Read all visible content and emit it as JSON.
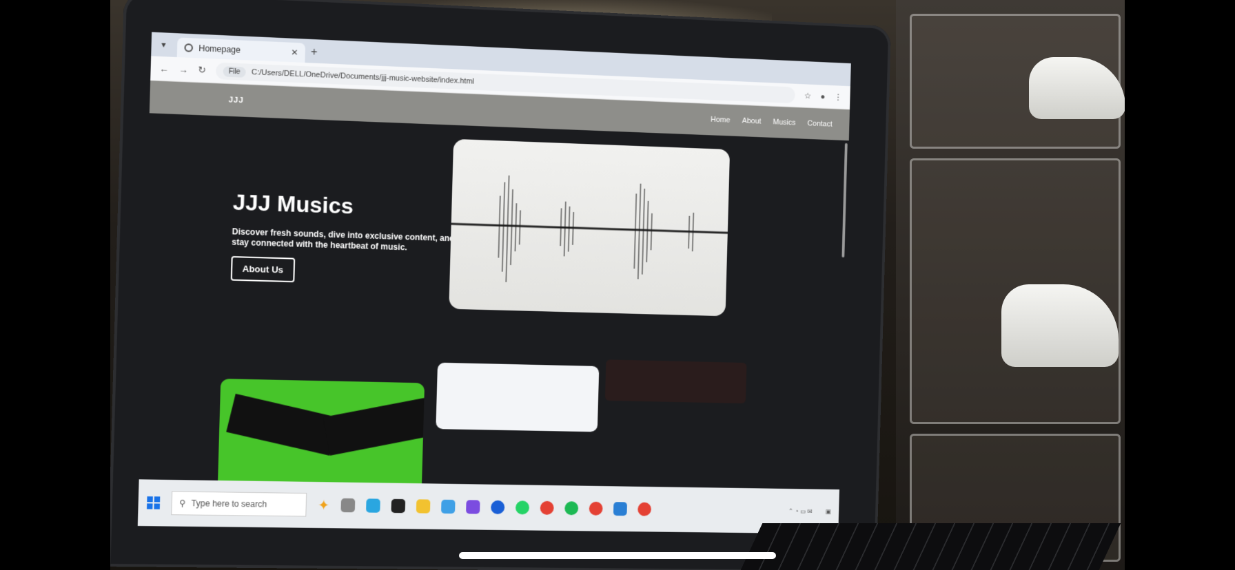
{
  "browser": {
    "tab_title": "Homepage",
    "file_chip": "File",
    "address": "C:/Users/DELL/OneDrive/Documents/jjj-music-website/index.html"
  },
  "site": {
    "logo": "JJJ",
    "nav": [
      "Home",
      "About",
      "Musics",
      "Contact"
    ],
    "hero_title": "JJJ Musics",
    "hero_subtitle": "Discover fresh sounds, dive into exclusive content, and stay connected with the heartbeat of music.",
    "hero_button": "About Us"
  },
  "taskbar": {
    "search_placeholder": "Type here to search"
  }
}
